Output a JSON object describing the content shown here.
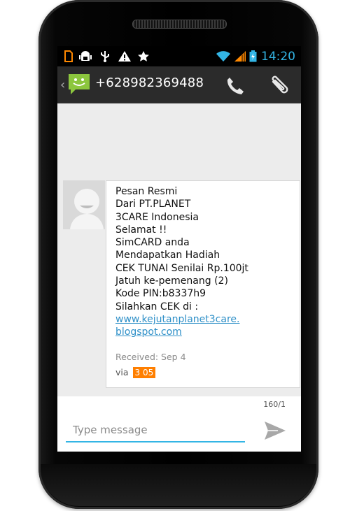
{
  "status_bar": {
    "time": "14:20",
    "icons": [
      "sim-card-icon",
      "android-debug-icon",
      "usb-icon",
      "warning-icon",
      "star-icon",
      "wifi-icon",
      "signal-icon",
      "battery-icon"
    ]
  },
  "header": {
    "contact_number": "+628982369488",
    "icons": [
      "back-caret-icon",
      "messaging-app-icon",
      "phone-call-icon",
      "attachment-icon"
    ]
  },
  "message": {
    "lines": [
      "Pesan Resmi",
      "Dari PT.PLANET",
      "3CARE Indonesia",
      "Selamat !!",
      "SimCARD anda",
      "Mendapatkan Hadiah",
      "CEK TUNAI Senilai Rp.100jt",
      "Jatuh ke-pemenang (2)",
      "Kode PIN:b8337h9",
      "Silahkan CEK di :"
    ],
    "link_lines": [
      "www.kejutanplanet3care.",
      "blogspot.com"
    ],
    "received": "Received: Sep 4",
    "via_label": "via",
    "via_badge": "3 05"
  },
  "compose": {
    "char_count": "160/1",
    "placeholder": "Type message"
  },
  "colors": {
    "accent": "#33b5e5",
    "action_bar": "#2b2b2b",
    "conversation_bg": "#ececec",
    "link": "#2f90c8",
    "badge": "#ff7f00",
    "signal": "#ff8800"
  }
}
